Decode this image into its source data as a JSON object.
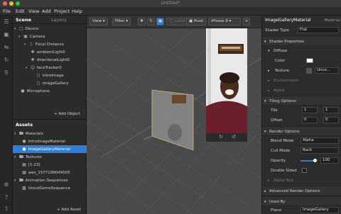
{
  "window": {
    "title": "Untitled*"
  },
  "menu": [
    "File",
    "Edit",
    "View",
    "Add",
    "Project",
    "Help"
  ],
  "scene_panel": {
    "tabs": [
      "Scene",
      "Layers"
    ],
    "items": [
      {
        "label": "Device"
      },
      {
        "label": "Camera"
      },
      {
        "label": "Focal Distance"
      },
      {
        "label": "ambientLight0"
      },
      {
        "label": "directionalLight0"
      },
      {
        "label": "faceTracker0"
      },
      {
        "label": "introImage"
      },
      {
        "label": "imageGallery"
      },
      {
        "label": "Microphone"
      }
    ],
    "add_button": "+ Add Object"
  },
  "assets_panel": {
    "title": "Assets",
    "items": [
      {
        "label": "Materials"
      },
      {
        "label": "IntroImageMaterial"
      },
      {
        "label": "ImageGalleryMaterial"
      },
      {
        "label": "Textures"
      },
      {
        "label": "[1-23]"
      },
      {
        "label": "aws_1577199049505"
      },
      {
        "label": "Animation Sequences"
      },
      {
        "label": "UncutGemsSequence"
      }
    ],
    "add_button": "+ Add Asset"
  },
  "viewport": {
    "view_label": "View",
    "filter_label": "Filter",
    "local_label": "Local",
    "pivot_label": "Pivot",
    "device_label": "iPhone 8"
  },
  "inspector": {
    "title": "ImageGalleryMaterial",
    "subtitle": "Material",
    "shader_type_label": "Shader Type",
    "shader_type_value": "Flat",
    "shader_properties": "Shader Properties",
    "diffuse": "Diffuse",
    "color_label": "Color",
    "texture_label": "Texture",
    "texture_value": "Unco...",
    "environment": "Environment",
    "alpha": "Alpha",
    "tiling_options": "Tiling Options",
    "tile_label": "Tile",
    "tile_x": "1",
    "tile_y": "1",
    "offset_label": "Offset",
    "offset_x": "0",
    "offset_y": "0",
    "render_options": "Render Options",
    "blend_mode_label": "Blend Mode",
    "blend_mode_value": "Alpha",
    "cull_mode_label": "Cull Mode",
    "cull_mode_value": "Back",
    "opacity_label": "Opacity",
    "opacity_value": "100",
    "double_sided_label": "Double Sided",
    "alpha_test_label": "Alpha Test",
    "advanced_render": "Advanced Render Options",
    "used_by": "Used By",
    "plane_label": "Plane",
    "plane_value": "ImageGallery"
  },
  "colors": {
    "selection": "#2f7fd8",
    "panel": "#2b2b2b",
    "viewport": "#4a4a4a"
  }
}
